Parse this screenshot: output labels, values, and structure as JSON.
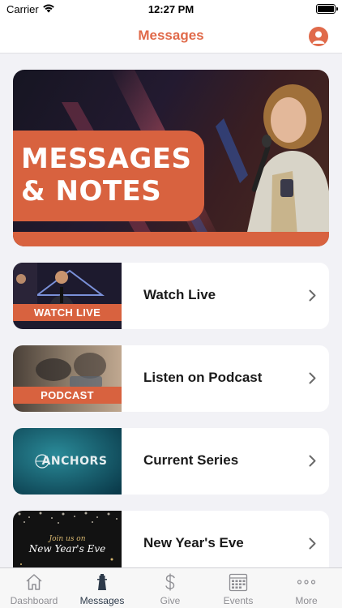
{
  "status_bar": {
    "carrier": "Carrier",
    "time": "12:27 PM"
  },
  "nav": {
    "title": "Messages"
  },
  "hero": {
    "line1": "MESSAGES",
    "line2": "& NOTES"
  },
  "cards": [
    {
      "label": "Watch Live",
      "thumb_text": "WATCH LIVE"
    },
    {
      "label": "Listen on Podcast",
      "thumb_text": "PODCAST"
    },
    {
      "label": "Current Series",
      "thumb_text": "ANCHORS"
    },
    {
      "label": "New Year's Eve",
      "thumb_small": "Join us on",
      "thumb_text": "New Year's Eve"
    }
  ],
  "tabs": [
    {
      "label": "Dashboard",
      "icon": "house-icon"
    },
    {
      "label": "Messages",
      "icon": "lighthouse-icon",
      "active": true
    },
    {
      "label": "Give",
      "icon": "dollar-icon"
    },
    {
      "label": "Events",
      "icon": "calendar-icon"
    },
    {
      "label": "More",
      "icon": "more-dots-icon"
    }
  ],
  "colors": {
    "accent": "#e06a4a",
    "band": "#d8623f",
    "active_tab": "#2d3a4a",
    "inactive_tab": "#8e8e93"
  }
}
